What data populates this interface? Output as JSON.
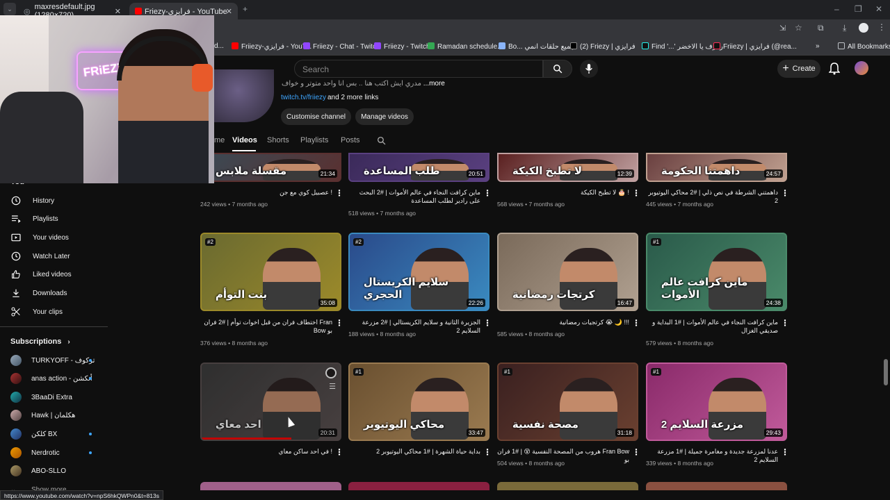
{
  "browser": {
    "tabs": [
      {
        "title": "maxresdefault.jpg (1280×720)"
      },
      {
        "title": "Friezy-فرايزي - YouTube"
      }
    ],
    "bookmarks": [
      "d...",
      "Friiezy-فرايزي - YouT...",
      "Friiezy - Chat - Twitch",
      "Friiezy - Twitch",
      "Ramadan schedule...",
      "Bo... جميع حلقات انمي",
      "(2) Friezy | فرايزي",
      "Find '...' رفرف يا الاخضر",
      "Friiezy | فرايزي (@rea...",
      "All Bookmarks"
    ]
  },
  "header": {
    "search_placeholder": "Search",
    "create_label": "Create"
  },
  "channel": {
    "about_more": "...more",
    "about_snippet": "مدري ايش اكتب هنا .. بس انا واحد متوتر و خواف",
    "link": "twitch.tv/friiezy",
    "more_links": "and 2 more links",
    "customize_btn": "Customise channel",
    "manage_btn": "Manage videos"
  },
  "nav_tabs": {
    "home": "me",
    "videos": "Videos",
    "shorts": "Shorts",
    "playlists": "Playlists",
    "posts": "Posts"
  },
  "sidebar": {
    "you_label": "You",
    "items": [
      "History",
      "Playlists",
      "Your videos",
      "Watch Later",
      "Liked videos",
      "Downloads",
      "Your clips"
    ],
    "subscriptions_label": "Subscriptions",
    "subs": [
      "TURKYOFF - تركوف",
      "anas action - أنكشن",
      "3BaaDi Extra",
      "Hawk | هكلمان",
      "كلكن BX",
      "Nerdrotic",
      "ABO-SLLO",
      "Show more"
    ]
  },
  "videos": [
    {
      "title": "! عصبيل كوي مع جن",
      "meta": "242 views • 7 months ago",
      "dur": "21:34",
      "thumb_text": "مقسلة ملابس",
      "colors": [
        "#3a4a55",
        "#5a3030"
      ]
    },
    {
      "title": "ماين كرافت النجاء في عالم الأموات | #2 البحث على رادير لطلب المساعدة",
      "meta": "518 views • 7 months ago",
      "dur": "20:51",
      "thumb_text": "طلب المساعدة",
      "colors": [
        "#3b2a5a",
        "#5a4080"
      ]
    },
    {
      "title": "! 🎂 لا تطبخ الكيكة",
      "meta": "568 views • 7 months ago",
      "dur": "12:39",
      "thumb_text": "لا تطبخ الكيكة",
      "colors": [
        "#5a2020",
        "#c0a0a0"
      ]
    },
    {
      "title": "داهمتني الشرطة في نص ذلي | #2 محاكي اليوتيوبر 2",
      "meta": "445 views • 7 months ago",
      "dur": "24:57",
      "thumb_text": "داهمتنا الحكومة",
      "colors": [
        "#6a4040",
        "#c0a090"
      ]
    },
    {
      "title": "Fran اختطاف فران من قبل اخوات توأم | #2 فران بو Bow",
      "meta": "376 views • 8 months ago",
      "dur": "35:08",
      "thumb_text": "بنت التوأم",
      "badge": "#2",
      "colors": [
        "#6a6a30",
        "#9c8a2a"
      ]
    },
    {
      "title": "الجزيرة الثانية و سلايم الكريستالي | #2 مزرعة السلايم 2",
      "meta": "188 views • 8 months ago",
      "dur": "22:26",
      "thumb_text": "سلايم الكريستال الحجري",
      "badge": "#2",
      "colors": [
        "#2a4a8a",
        "#3a8ac0"
      ]
    },
    {
      "title": "!!! 🌙 😭 كرتجيات رمضانية",
      "meta": "585 views • 8 months ago",
      "dur": "16:47",
      "thumb_text": "كرتجات رمضانية",
      "colors": [
        "#7a6a5a",
        "#b0a090"
      ]
    },
    {
      "title": "ماين كرافت النجاء في عالم الأموات | #1 البداية و صديقي الغزال",
      "meta": "579 views • 8 months ago",
      "dur": "24:38",
      "thumb_text": "ماين كرافت عالم الأموات",
      "badge": "#1",
      "colors": [
        "#2a5a4a",
        "#4a8a6a"
      ]
    },
    {
      "title": "! في احد ساكن معاي",
      "meta": "",
      "dur": "20:31",
      "thumb_text": "احد معاي",
      "colors": [
        "#3a3a3a",
        "#5a5050"
      ]
    },
    {
      "title": "بداية حياة الشهرة | #1 محاكي اليوتيوبر 2",
      "meta": "",
      "dur": "33:47",
      "thumb_text": "محاكي اليوتيوبر",
      "badge": "#1",
      "colors": [
        "#6a5030",
        "#9a7a50"
      ]
    },
    {
      "title": "Fran Bow هروب من المصحة النفسية 😵 | #1 فران بو",
      "meta": "504 views • 8 months ago",
      "dur": "31:18",
      "thumb_text": "مصحة نفسية",
      "badge": "#1",
      "colors": [
        "#3a2020",
        "#6a4030"
      ]
    },
    {
      "title": "عدنا لمزرعة جديدة و مغامرة جميلة | #1 مزرعة السلايم 2",
      "meta": "339 views • 8 months ago",
      "dur": "29:43",
      "thumb_text": "مزرعة السلايم 2",
      "badge": "#1",
      "colors": [
        "#8a2a6a",
        "#c05a9a"
      ]
    }
  ],
  "status_url": "https://www.youtube.com/watch?v=npS6hkQWPn0&t=813s",
  "webcam_sign": "FRiEZY"
}
